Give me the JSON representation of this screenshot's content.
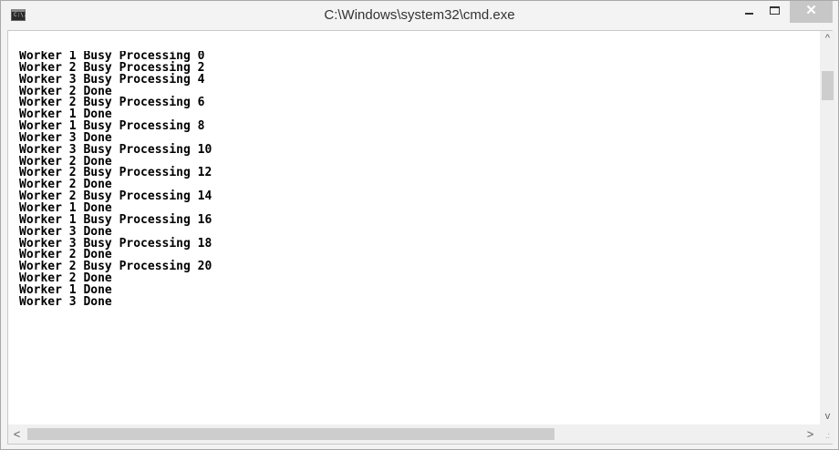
{
  "window": {
    "title": "C:\\Windows\\system32\\cmd.exe",
    "icon_text": "C:\\."
  },
  "controls": {
    "minimize": "minimize-icon",
    "maximize": "maximize-icon",
    "close": "✕"
  },
  "console": {
    "lines": [
      "Worker 1 Busy Processing 0",
      "Worker 2 Busy Processing 2",
      "Worker 3 Busy Processing 4",
      "Worker 2 Done",
      "Worker 2 Busy Processing 6",
      "Worker 1 Done",
      "Worker 1 Busy Processing 8",
      "Worker 3 Done",
      "Worker 3 Busy Processing 10",
      "Worker 2 Done",
      "Worker 2 Busy Processing 12",
      "Worker 2 Done",
      "Worker 2 Busy Processing 14",
      "Worker 1 Done",
      "Worker 1 Busy Processing 16",
      "Worker 3 Done",
      "Worker 3 Busy Processing 18",
      "Worker 2 Done",
      "Worker 2 Busy Processing 20",
      "Worker 2 Done",
      "Worker 1 Done",
      "Worker 3 Done"
    ]
  },
  "scrollbars": {
    "up": "^",
    "down": "v",
    "left": "<",
    "right": ">"
  },
  "grip": ".:"
}
